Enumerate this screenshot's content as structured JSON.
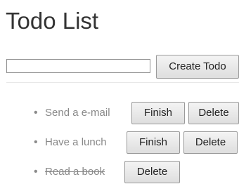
{
  "page": {
    "title": "Todo List"
  },
  "form": {
    "input_value": "",
    "input_placeholder": "",
    "create_label": "Create Todo"
  },
  "todos": [
    {
      "text": "Send a e-mail",
      "completed": false,
      "finish_label": "Finish",
      "delete_label": "Delete"
    },
    {
      "text": "Have a lunch",
      "completed": false,
      "finish_label": "Finish",
      "delete_label": "Delete"
    },
    {
      "text": "Read a book",
      "completed": true,
      "delete_label": "Delete"
    }
  ],
  "bullet": "•",
  "colors": {
    "text": "#333333",
    "muted": "#888888",
    "button_top": "#f4f4f4",
    "button_bottom": "#dedede",
    "button_border": "#9a9a9a"
  }
}
